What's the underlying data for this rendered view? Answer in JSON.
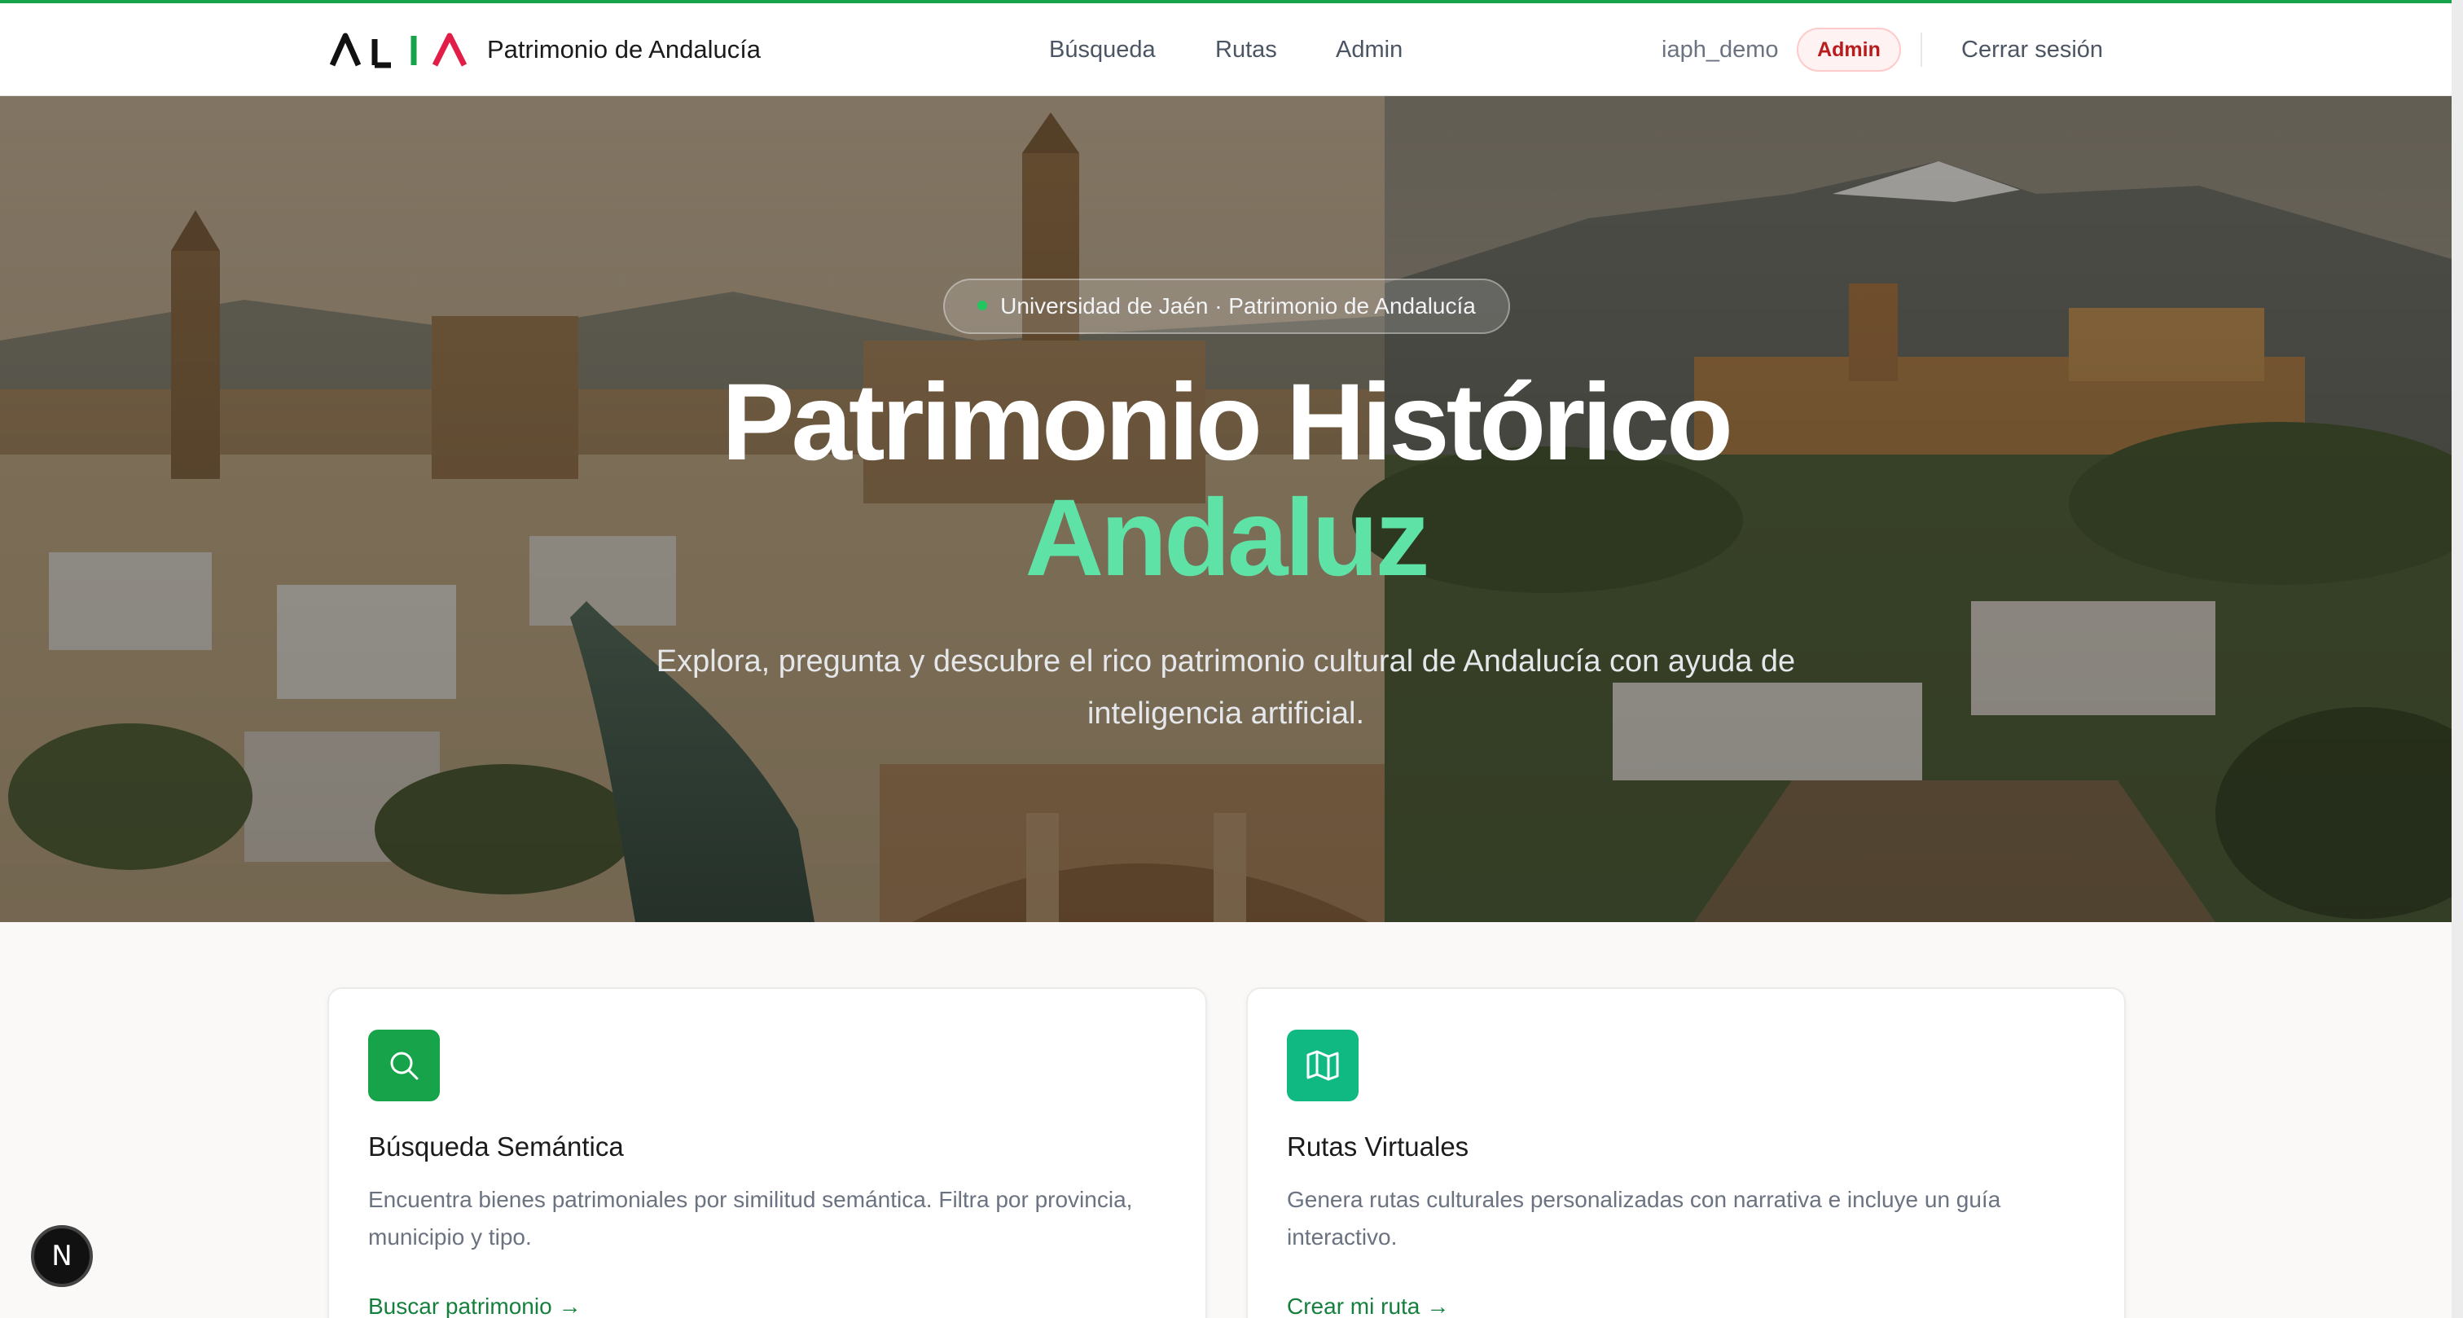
{
  "header": {
    "brand": "Patrimonio de Andalucía",
    "logo_text": "ALIA",
    "nav": [
      "Búsqueda",
      "Rutas",
      "Admin"
    ],
    "username": "iaph_demo",
    "role_badge": "Admin",
    "logout": "Cerrar sesión"
  },
  "hero": {
    "pill": "Universidad de Jaén · Patrimonio de Andalucía",
    "title_line1": "Patrimonio Histórico",
    "title_line2": "Andaluz",
    "subtitle": "Explora, pregunta y descubre el rico patrimonio cultural de Andalucía con ayuda de inteligencia artificial."
  },
  "features": [
    {
      "icon": "search-icon",
      "title": "Búsqueda Semántica",
      "description": "Encuentra bienes patrimoniales por similitud semántica. Filtra por provincia, municipio y tipo.",
      "link": "Buscar patrimonio"
    },
    {
      "icon": "map-icon",
      "title": "Rutas Virtuales",
      "description": "Genera rutas culturales personalizadas con narrativa e incluye un guía interactivo.",
      "link": "Crear mi ruta"
    }
  ],
  "fab": {
    "label": "N"
  },
  "colors": {
    "accent": "#16a34a",
    "hero_highlight": "#5ee2a6",
    "badge_text": "#b91c1c",
    "badge_bg": "#fef2f2",
    "link": "#15803d"
  }
}
